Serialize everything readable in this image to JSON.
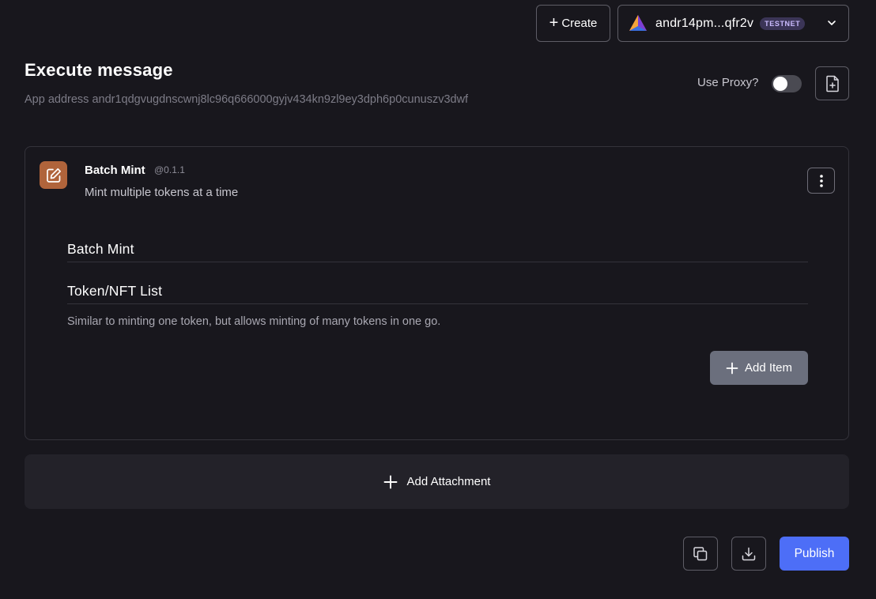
{
  "header": {
    "create_label": "Create",
    "wallet_address": "andr14pm...qfr2v",
    "network_badge": "TESTNET"
  },
  "page": {
    "title": "Execute message",
    "app_address": "App address andr1qdgvugdnscwnj8lc96q666000gyjv434kn9zl9ey3dph6p0cunuszv3dwf",
    "proxy_label": "Use Proxy?",
    "proxy_enabled": false
  },
  "module": {
    "name": "Batch Mint",
    "version": "@0.1.1",
    "description": "Mint multiple tokens at a time",
    "icon": "edit-icon",
    "icon_color": "#b0643b",
    "section_title": "Batch Mint",
    "field_title": "Token/NFT List",
    "field_help": "Similar to minting one token, but allows minting of many tokens in one go.",
    "add_item_label": "Add Item"
  },
  "attachment": {
    "label": "Add Attachment"
  },
  "actions": {
    "publish_label": "Publish",
    "publish_color": "#4d6ef7"
  },
  "icons": {
    "copy": "copy-icon",
    "download": "download-icon",
    "file": "file-plus-icon",
    "menu": "more-vertical-icon"
  }
}
